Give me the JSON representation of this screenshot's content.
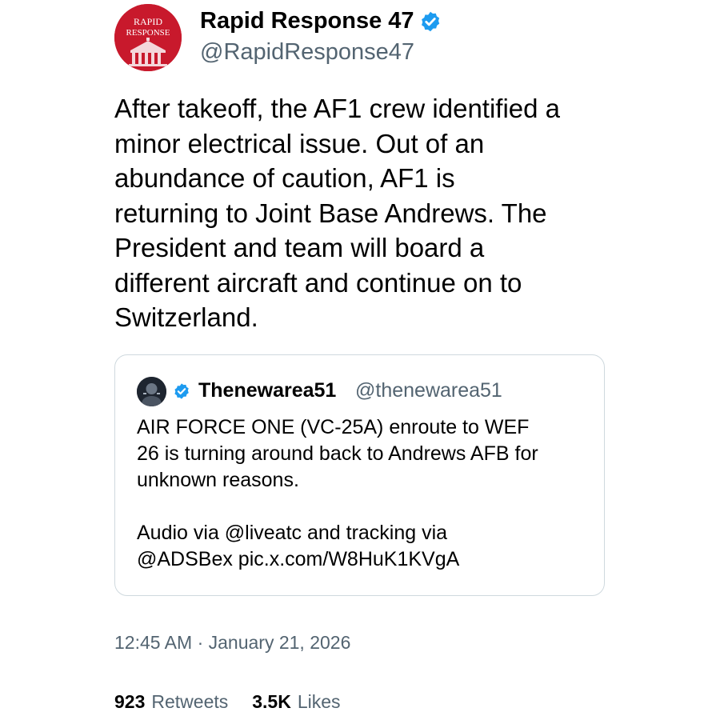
{
  "author": {
    "display_name": "Rapid Response 47",
    "handle": "@RapidResponse47",
    "verified": true,
    "avatar_icon": "white-house-logo-icon",
    "avatar_text_line1": "RAPID",
    "avatar_text_line2": "RESPONSE"
  },
  "tweet": {
    "text": "After takeoff, the AF1 crew identified a\nminor electrical issue. Out of an\nabundance of caution, AF1 is\nreturning to Joint Base Andrews. The\nPresident and team will board a\ndifferent aircraft and continue on to\nSwitzerland."
  },
  "quote": {
    "display_name": "Thenewarea51",
    "handle": "@thenewarea51",
    "verified": true,
    "avatar_icon": "profile-photo-icon",
    "text": "AIR FORCE ONE (VC-25A) enroute to WEF\n26 is turning around back to Andrews AFB for\nunknown reasons.\n\nAudio via @liveatc and tracking via\n@ADSBex pic.x.com/W8HuK1KVgA"
  },
  "timestamp": "12:45 AM · January 21, 2026",
  "stats": {
    "retweets_count": "923",
    "retweets_label": "Retweets",
    "likes_count": "3.5K",
    "likes_label": "Likes"
  },
  "colors": {
    "accent_blue": "#1d9bf0",
    "avatar_red": "#c8192c",
    "secondary_text": "#536471",
    "border": "#cfd9de"
  }
}
